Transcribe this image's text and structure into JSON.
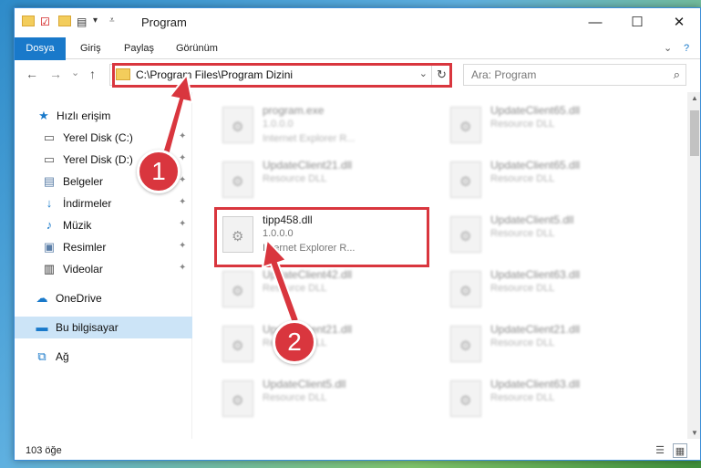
{
  "window": {
    "title": "Program",
    "minimize": "—",
    "maximize": "☐",
    "close": "✕"
  },
  "ribbon": {
    "tabs": [
      "Dosya",
      "Giriş",
      "Paylaş",
      "Görünüm"
    ],
    "expand": "⌄",
    "help": "?"
  },
  "nav": {
    "back": "←",
    "forward": "→",
    "recent": "⌄",
    "up": "↑",
    "address": "C:\\Program Files\\Program Dizini",
    "dropdown": "⌄",
    "refresh": "↻",
    "search_placeholder": "Ara: Program",
    "search_icon": "⌕"
  },
  "sidebar": {
    "items": [
      {
        "label": "Hızlı erişim",
        "icon": "star-icon",
        "glyph": "★",
        "pinned": false
      },
      {
        "label": "Yerel Disk (C:)",
        "icon": "drive-icon",
        "glyph": "▭",
        "pinned": true
      },
      {
        "label": "Yerel Disk (D:)",
        "icon": "drive-icon",
        "glyph": "▭",
        "pinned": true
      },
      {
        "label": "Belgeler",
        "icon": "documents-icon",
        "glyph": "▤",
        "pinned": true
      },
      {
        "label": "İndirmeler",
        "icon": "download-icon",
        "glyph": "↓",
        "pinned": true
      },
      {
        "label": "Müzik",
        "icon": "music-icon",
        "glyph": "♪",
        "pinned": true
      },
      {
        "label": "Resimler",
        "icon": "pictures-icon",
        "glyph": "▣",
        "pinned": true
      },
      {
        "label": "Videolar",
        "icon": "video-icon",
        "glyph": "▥",
        "pinned": true
      },
      {
        "label": "OneDrive",
        "icon": "cloud-icon",
        "glyph": "☁",
        "pinned": false
      },
      {
        "label": "Bu bilgisayar",
        "icon": "computer-icon",
        "glyph": "▬",
        "pinned": false
      },
      {
        "label": "Ağ",
        "icon": "network-icon",
        "glyph": "⧉",
        "pinned": false
      }
    ],
    "pin_glyph": "📌"
  },
  "files": {
    "left": [
      {
        "name": "program.exe",
        "line2": "1.0.0.0",
        "line3": "Internet Explorer R..."
      },
      {
        "name": "UpdateClient21.dll",
        "line2": "Resource DLL",
        "line3": ""
      },
      {
        "name": "tipp458.dll",
        "line2": "1.0.0.0",
        "line3": "Internet Explorer R..."
      },
      {
        "name": "UpdateClient42.dll",
        "line2": "Resource DLL",
        "line3": ""
      },
      {
        "name": "UpdateClient21.dll",
        "line2": "Resource DLL",
        "line3": ""
      },
      {
        "name": "UpdateClient5.dll",
        "line2": "Resource DLL",
        "line3": ""
      }
    ],
    "right": [
      {
        "name": "UpdateClient65.dll",
        "line2": "Resource DLL",
        "line3": ""
      },
      {
        "name": "UpdateClient65.dll",
        "line2": "Resource DLL",
        "line3": ""
      },
      {
        "name": "UpdateClient5.dll",
        "line2": "Resource DLL",
        "line3": ""
      },
      {
        "name": "UpdateClient63.dll",
        "line2": "Resource DLL",
        "line3": ""
      },
      {
        "name": "UpdateClient21.dll",
        "line2": "Resource DLL",
        "line3": ""
      },
      {
        "name": "UpdateClient63.dll",
        "line2": "Resource DLL",
        "line3": ""
      }
    ]
  },
  "status": {
    "count": "103 öğe"
  },
  "annotations": {
    "step1": "1",
    "step2": "2",
    "color": "#d9363e"
  }
}
